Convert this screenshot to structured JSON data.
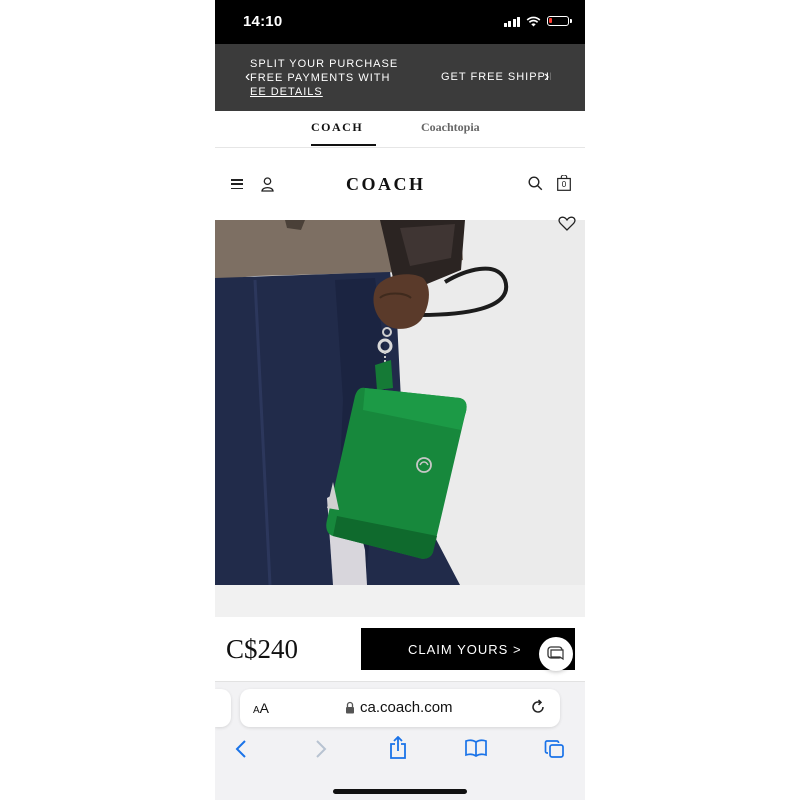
{
  "status_bar": {
    "time": "14:10",
    "battery_level": 0.15,
    "battery_color": "#ff3b30",
    "icons": [
      "cellular-signal-icon",
      "wifi-icon",
      "battery-icon"
    ]
  },
  "promo_banner": {
    "left_line1": "SPLIT YOUR PURCHASE",
    "left_line2": "FREE PAYMENTS WITH",
    "left_link": "EE DETAILS",
    "right_text": "GET FREE SHIPPIN",
    "prev_arrow": "‹",
    "next_arrow": "›",
    "background": "#3b3b3b"
  },
  "brand_tabs": {
    "items": [
      {
        "label": "COACH",
        "active": true
      },
      {
        "label": "Coachtopia",
        "active": false
      }
    ]
  },
  "header": {
    "logo": "COACH",
    "bag_count": "0",
    "icons": [
      "menu-icon",
      "user-icon",
      "search-icon",
      "shopping-bag-icon"
    ]
  },
  "product": {
    "image": "green-leather-wristlet-on-model",
    "wishlist_icon": "heart-icon",
    "accent_color": "#1a7a3a"
  },
  "purchase_bar": {
    "price": "C$240",
    "cta_label": "CLAIM YOURS >",
    "chat_icon": "chat-bubble-icon"
  },
  "safari": {
    "text_size_label_small": "A",
    "text_size_label_large": "A",
    "url": "ca.coach.com",
    "icons": [
      "lock-icon",
      "reload-icon",
      "back-icon",
      "forward-icon",
      "share-icon",
      "bookmarks-icon",
      "tabs-icon"
    ],
    "accent": "#1a73e8"
  }
}
